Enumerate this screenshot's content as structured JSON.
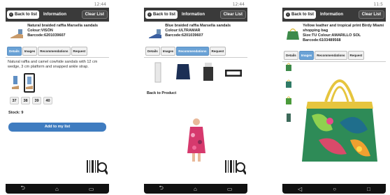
{
  "screens": [
    {
      "status_time": "12:44",
      "back_label": "Back to list",
      "title": "Information",
      "clear_label": "Clear List",
      "product_name": "Natural braided raffia Marsella sandals Colour:VISÓN",
      "barcode": "Barcode:6201039607",
      "tabs": [
        "Details",
        "Images",
        "Recommendations",
        "Request"
      ],
      "active_tab": "Details",
      "description": "Natural raffia and camel cowhide sandals with 12 cm wedge, 3 cm platform and snapped ankle strap.",
      "sizes": [
        "37",
        "38",
        "39",
        "40"
      ],
      "stock_label": "Stock:",
      "stock_value": "9",
      "add_button": "Add to my list"
    },
    {
      "status_time": "12:44",
      "back_label": "Back to list",
      "title": "Information",
      "clear_label": "Clear List",
      "product_name": "Blue braided raffia Marsella sandals Colour:ULTRAMAR",
      "barcode": "Barcode:6201039607",
      "tabs": [
        "Details",
        "Images",
        "Recommendations",
        "Request"
      ],
      "active_tab": "Recommendations",
      "back_to_product": "Back to Product"
    },
    {
      "status_time": "11:5",
      "back_label": "Back to list",
      "title": "Information",
      "clear_label": "Clear List",
      "product_name": "Yellow leather and tropical print Birdy Miami shopping bag",
      "size_colour": "Size:TU Colour:AMARILLO SOL",
      "barcode": "Barcode:6103489568",
      "tabs": [
        "Details",
        "Images",
        "Recommendations",
        "Request"
      ],
      "active_tab": "Images"
    }
  ],
  "colors": {
    "accent": "#6aa2d6",
    "appbar": "#3a3a3a",
    "button": "#3f7cc0"
  }
}
